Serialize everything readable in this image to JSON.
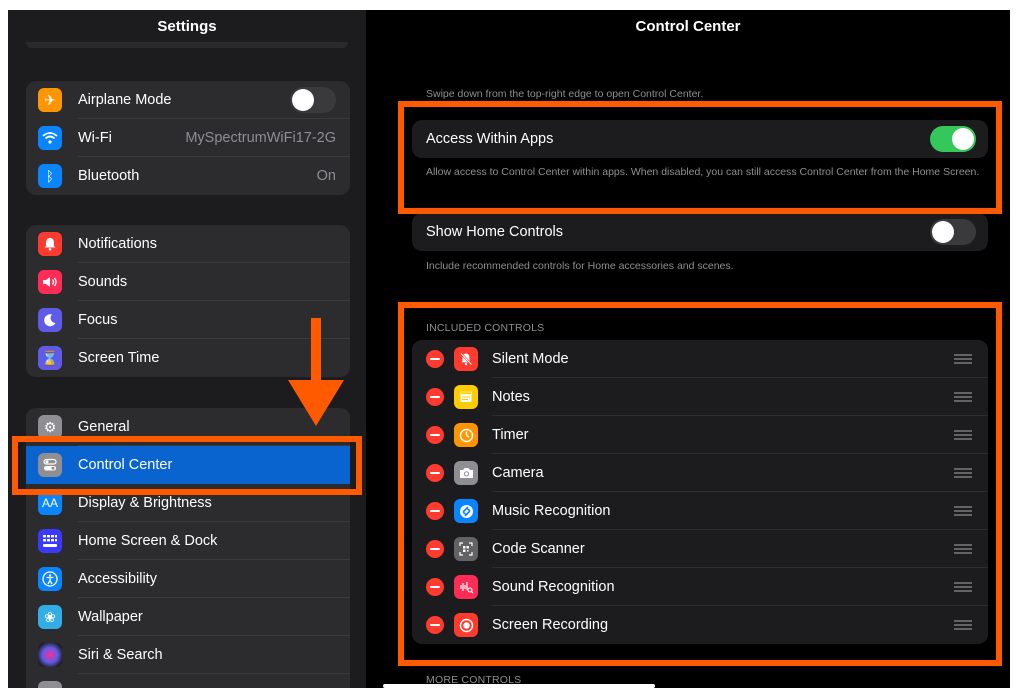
{
  "sidebar": {
    "title": "Settings",
    "groups": [
      [
        {
          "label": "Airplane Mode",
          "icon": "airplane-icon",
          "color": "#ff9500",
          "toggle": false
        },
        {
          "label": "Wi-Fi",
          "icon": "wifi-icon",
          "color": "#0a84ff",
          "value": "MySpectrumWiFi17-2G"
        },
        {
          "label": "Bluetooth",
          "icon": "bluetooth-icon",
          "color": "#0a84ff",
          "value": "On"
        }
      ],
      [
        {
          "label": "Notifications",
          "icon": "bell-icon",
          "color": "#ff3b30"
        },
        {
          "label": "Sounds",
          "icon": "speaker-icon",
          "color": "#ff2d55"
        },
        {
          "label": "Focus",
          "icon": "moon-icon",
          "color": "#5e5ce6"
        },
        {
          "label": "Screen Time",
          "icon": "hourglass-icon",
          "color": "#5e5ce6"
        }
      ],
      [
        {
          "label": "General",
          "icon": "gear-icon",
          "color": "#8e8e93"
        },
        {
          "label": "Control Center",
          "icon": "switches-icon",
          "color": "#8e8e93",
          "selected": true
        },
        {
          "label": "Display & Brightness",
          "icon": "text-size-icon",
          "color": "#0a84ff"
        },
        {
          "label": "Home Screen & Dock",
          "icon": "grid-icon",
          "color": "#3a3aff"
        },
        {
          "label": "Accessibility",
          "icon": "accessibility-icon",
          "color": "#0a84ff"
        },
        {
          "label": "Wallpaper",
          "icon": "flower-icon",
          "color": "#32ade6"
        },
        {
          "label": "Siri & Search",
          "icon": "siri-icon",
          "color": "#333333"
        }
      ]
    ]
  },
  "detail": {
    "title": "Control Center",
    "intro": "Swipe down from the top-right edge to open Control Center.",
    "access_within_apps": {
      "label": "Access Within Apps",
      "on": true,
      "footer": "Allow access to Control Center within apps. When disabled, you can still access Control Center from the Home Screen."
    },
    "show_home_controls": {
      "label": "Show Home Controls",
      "on": false,
      "footer": "Include recommended controls for Home accessories and scenes."
    },
    "included_header": "INCLUDED CONTROLS",
    "included": [
      {
        "label": "Silent Mode",
        "icon": "bell-slash-icon",
        "color": "#ff3b30"
      },
      {
        "label": "Notes",
        "icon": "notes-icon",
        "color": "#ffcc00"
      },
      {
        "label": "Timer",
        "icon": "timer-icon",
        "color": "#ff9500"
      },
      {
        "label": "Camera",
        "icon": "camera-icon",
        "color": "#8e8e93"
      },
      {
        "label": "Music Recognition",
        "icon": "shazam-icon",
        "color": "#0a84ff"
      },
      {
        "label": "Code Scanner",
        "icon": "qr-code-icon",
        "color": "#636366"
      },
      {
        "label": "Sound Recognition",
        "icon": "waveform-icon",
        "color": "#ff2d55"
      },
      {
        "label": "Screen Recording",
        "icon": "record-icon",
        "color": "#ff3b30"
      }
    ],
    "more_header": "MORE CONTROLS"
  },
  "annotations": {
    "color": "#ff5a00"
  }
}
